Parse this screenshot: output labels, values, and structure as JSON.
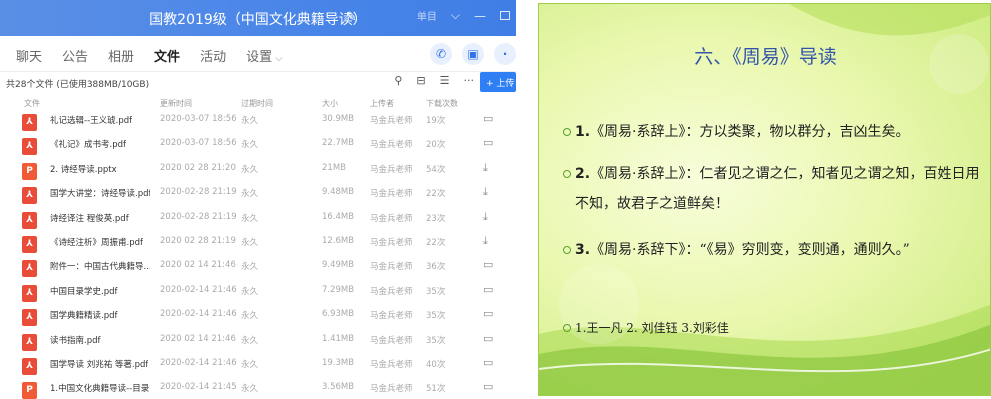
{
  "window": {
    "title": "国教2019级（中国文化典籍导读）",
    "title_icon": "edit-pencil",
    "user_label": "单目",
    "accent": "#4a86e8",
    "tabs": [
      {
        "label": "聊天"
      },
      {
        "label": "公告"
      },
      {
        "label": "相册"
      },
      {
        "label": "文件"
      },
      {
        "label": "活动"
      },
      {
        "label": "设置"
      }
    ],
    "active_tab": "文件",
    "summary": "共28个文件 (已使用388MB/10GB)",
    "upload_label": "+ 上传",
    "columns": {
      "name": "文件",
      "updated": "更新时间",
      "expire": "过期时间",
      "size": "大小",
      "uploader": "上传者",
      "downloads": "下载次数"
    },
    "files": [
      {
        "type": "pdf",
        "icon": "pdf-icon",
        "name": "礼记选辑--王义琥.pdf",
        "updated": "2020-03-07 18:56",
        "expire": "永久",
        "size": "30.9MB",
        "uploader": "马金兵老师",
        "downloads": "19次",
        "action": "folder-icon"
      },
      {
        "type": "pdf",
        "icon": "pdf-icon",
        "name": "《礼记》成书考.pdf",
        "updated": "2020-03-07 18:56",
        "expire": "永久",
        "size": "22.7MB",
        "uploader": "马金兵老师",
        "downloads": "20次",
        "action": "folder-icon"
      },
      {
        "type": "ppt",
        "icon": "ppt-icon",
        "name": "2. 诗经导读.pptx",
        "updated": "2020 02 28 21:20",
        "expire": "永久",
        "size": "21MB",
        "uploader": "马金兵老师",
        "downloads": "54次",
        "action": "download-icon"
      },
      {
        "type": "pdf",
        "icon": "pdf-icon",
        "name": "国学大讲堂：诗经导读.pdf",
        "updated": "2020-02-28 21:19",
        "expire": "永久",
        "size": "9.48MB",
        "uploader": "马金兵老师",
        "downloads": "22次",
        "action": "download-icon"
      },
      {
        "type": "pdf",
        "icon": "pdf-icon",
        "name": "诗经译注 程俊英.pdf",
        "updated": "2020-02-28 21:19",
        "expire": "永久",
        "size": "16.4MB",
        "uploader": "马金兵老师",
        "downloads": "23次",
        "action": "download-icon"
      },
      {
        "type": "pdf",
        "icon": "pdf-icon",
        "name": "《诗经注析》周振甫.pdf",
        "updated": "2020 02 28 21:19",
        "expire": "永久",
        "size": "12.6MB",
        "uploader": "马金兵老师",
        "downloads": "22次",
        "action": "download-icon"
      },
      {
        "type": "pdf",
        "icon": "pdf-icon",
        "name": "附件一：中国古代典籍导...",
        "updated": "2020 02 14 21:46",
        "expire": "永久",
        "size": "9.49MB",
        "uploader": "马金兵老师",
        "downloads": "36次",
        "action": "folder-icon"
      },
      {
        "type": "pdf",
        "icon": "pdf-icon",
        "name": "中国目录学史.pdf",
        "updated": "2020-02-14 21:46",
        "expire": "永久",
        "size": "7.29MB",
        "uploader": "马金兵老师",
        "downloads": "35次",
        "action": "folder-icon"
      },
      {
        "type": "pdf",
        "icon": "pdf-icon",
        "name": "国学典籍精读.pdf",
        "updated": "2020-02-14 21:46",
        "expire": "永久",
        "size": "6.93MB",
        "uploader": "马金兵老师",
        "downloads": "35次",
        "action": "folder-icon"
      },
      {
        "type": "pdf",
        "icon": "pdf-icon",
        "name": "读书指南.pdf",
        "updated": "2020 02 14 21:46",
        "expire": "永久",
        "size": "1.41MB",
        "uploader": "马金兵老师",
        "downloads": "35次",
        "action": "folder-icon"
      },
      {
        "type": "pdf",
        "icon": "pdf-icon",
        "name": "国学导读 刘兆祐 等著.pdf",
        "updated": "2020-02-14 21:46",
        "expire": "永久",
        "size": "19.3MB",
        "uploader": "马金兵老师",
        "downloads": "40次",
        "action": "folder-icon"
      },
      {
        "type": "ppt",
        "icon": "ppt-icon",
        "name": "1.中国文化典籍导读--目录...",
        "updated": "2020-02-14 21:45",
        "expire": "永久",
        "size": "3.56MB",
        "uploader": "马金兵老师",
        "downloads": "51次",
        "action": "folder-icon"
      }
    ]
  },
  "slide": {
    "title": "六、《周易》导读",
    "bullets": [
      {
        "num": "1.",
        "text": "《周易·系辞上》：方以类聚，物以群分，吉凶生矣。"
      },
      {
        "num": "2.",
        "text": "《周易·系辞上》：仁者见之谓之仁，知者见之谓之知，百姓日用不知，故君子之道鲜矣！"
      },
      {
        "num": "3.",
        "text": "《周易·系辞下》：“《易》穷则变，变则通，通则久。”"
      }
    ],
    "credits": "1.王一凡 2. 刘佳钰 3.刘彩佳",
    "title_color": "#3355aa",
    "background_color": "#eaf8b0",
    "wave_color": "#9fd04a"
  }
}
